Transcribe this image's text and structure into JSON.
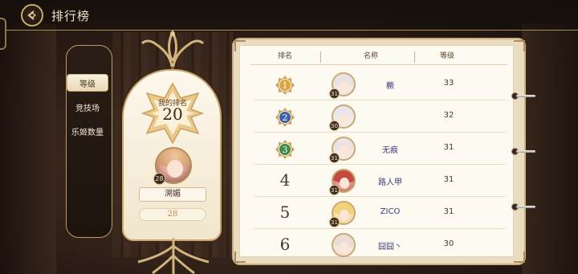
{
  "header": {
    "title": "排行榜"
  },
  "categories": [
    {
      "label": "等级",
      "active": true
    },
    {
      "label": "竞技场",
      "active": false
    },
    {
      "label": "乐姬数量",
      "active": false
    }
  ],
  "my_rank": {
    "label": "我的排名",
    "rank": "20",
    "level": "28",
    "name": "溯媚",
    "value": "28"
  },
  "board": {
    "columns": [
      "排名",
      "名称",
      "等级"
    ],
    "rows": [
      {
        "rank": "1",
        "medal": "gold",
        "level": "31",
        "name": "橛",
        "value": "33",
        "hair": "#e8e2e6"
      },
      {
        "rank": "2",
        "medal": "blue",
        "level": "30",
        "name": "",
        "value": "32",
        "hair": "#e9e6ee"
      },
      {
        "rank": "3",
        "medal": "green",
        "level": "31",
        "name": "无痕",
        "value": "31",
        "hair": "#ece4e4"
      },
      {
        "rank": "4",
        "medal": "",
        "level": "31",
        "name": "路人甲",
        "value": "31",
        "hair": "#c54a3e"
      },
      {
        "rank": "5",
        "medal": "",
        "level": "31",
        "name": "ZICO",
        "value": "31",
        "hair": "#f3d27e"
      },
      {
        "rank": "6",
        "medal": "",
        "level": "",
        "name": "囧囧丶",
        "value": "30",
        "hair": "#ecdcd6"
      }
    ]
  },
  "colors": {
    "accent_gold": "#c8ab72",
    "name_color": "#3d3a7a",
    "medal_gold": "#d9a441",
    "medal_blue": "#3f5fa8",
    "medal_green": "#3f8a4a"
  }
}
